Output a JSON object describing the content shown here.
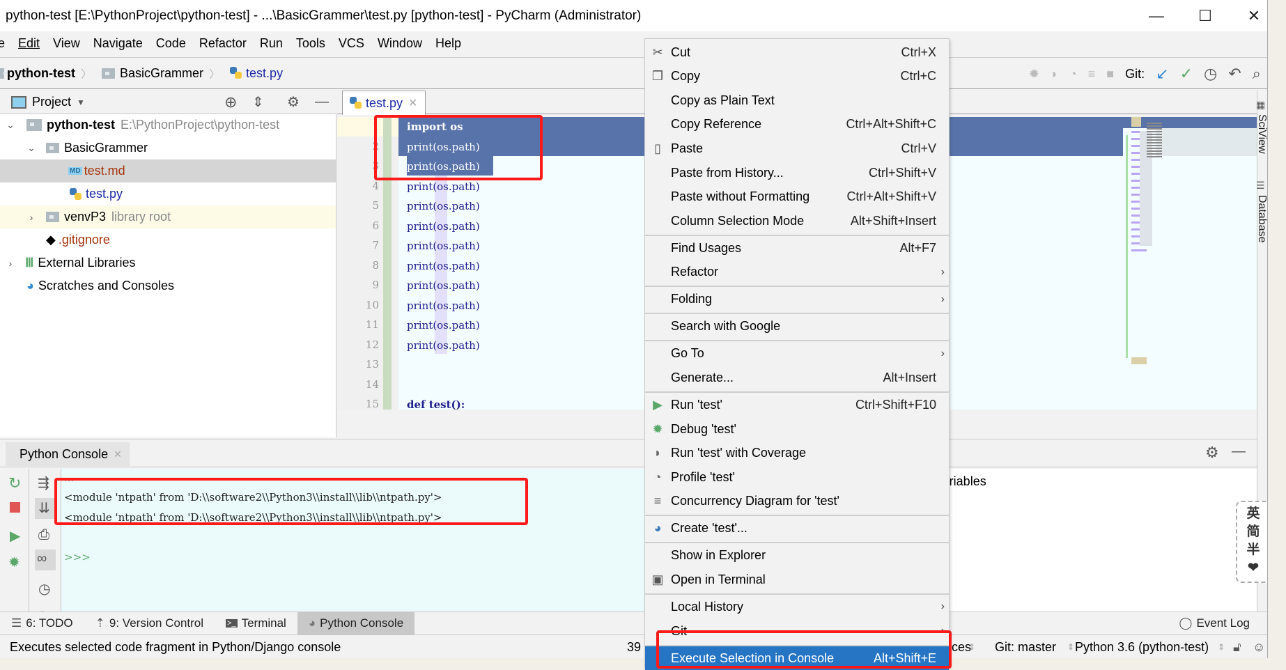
{
  "window": {
    "title": "python-test [E:\\PythonProject\\python-test] - ...\\BasicGrammer\\test.py [python-test] - PyCharm (Administrator)",
    "minimize": "—",
    "maximize": "☐",
    "close": "✕"
  },
  "menubar": [
    "e",
    "Edit",
    "View",
    "Navigate",
    "Code",
    "Refactor",
    "Run",
    "Tools",
    "VCS",
    "Window",
    "Help"
  ],
  "breadcrumb": [
    "python-test",
    "BasicGrammer",
    "test.py"
  ],
  "toolbar": {
    "git_label": "Git:"
  },
  "project": {
    "header": "Project",
    "tree": [
      {
        "label": "python-test",
        "hint": "E:\\PythonProject\\python-test"
      },
      {
        "label": "BasicGrammer"
      },
      {
        "label": "test.md"
      },
      {
        "label": "test.py"
      },
      {
        "label": "venvP3",
        "hint": "library root"
      },
      {
        "label": ".gitignore"
      },
      {
        "label": "External Libraries"
      },
      {
        "label": "Scratches and Consoles"
      }
    ]
  },
  "editor": {
    "tab": "test.py",
    "lines": [
      {
        "n": "1",
        "code": "import os"
      },
      {
        "n": "2",
        "code": "print(os.path)"
      },
      {
        "n": "3",
        "code": "print(os.path)"
      },
      {
        "n": "4",
        "code": "print(os.path)"
      },
      {
        "n": "5",
        "code": "print(os.path)"
      },
      {
        "n": "6",
        "code": "print(os.path)"
      },
      {
        "n": "7",
        "code": "print(os.path)"
      },
      {
        "n": "8",
        "code": "print(os.path)"
      },
      {
        "n": "9",
        "code": "print(os.path)"
      },
      {
        "n": "10",
        "code": "print(os.path)"
      },
      {
        "n": "11",
        "code": "print(os.path)"
      },
      {
        "n": "12",
        "code": "print(os.path)"
      },
      {
        "n": "13",
        "code": ""
      },
      {
        "n": "14",
        "code": ""
      },
      {
        "n": "15",
        "code": "def test():"
      }
    ]
  },
  "console": {
    "tab": "Python Console",
    "lines": [
      "...",
      "<module 'ntpath' from 'D:\\\\software2\\\\Python3\\\\install\\\\lib\\\\ntpath.py'>",
      "<module 'ntpath' from 'D:\\\\software2\\\\Python3\\\\install\\\\lib\\\\ntpath.py'>"
    ],
    "prompt": ">>>",
    "variables": "Variables"
  },
  "context_menu": [
    {
      "label": "Cut",
      "shortcut": "Ctrl+X",
      "icon": "scissors"
    },
    {
      "label": "Copy",
      "shortcut": "Ctrl+C",
      "icon": "copy"
    },
    {
      "label": "Copy as Plain Text",
      "shortcut": ""
    },
    {
      "label": "Copy Reference",
      "shortcut": "Ctrl+Alt+Shift+C"
    },
    {
      "label": "Paste",
      "shortcut": "Ctrl+V",
      "icon": "clipboard"
    },
    {
      "label": "Paste from History...",
      "shortcut": "Ctrl+Shift+V"
    },
    {
      "label": "Paste without Formatting",
      "shortcut": "Ctrl+Alt+Shift+V"
    },
    {
      "label": "Column Selection Mode",
      "shortcut": "Alt+Shift+Insert"
    },
    {
      "label": "Find Usages",
      "shortcut": "Alt+F7"
    },
    {
      "label": "Refactor",
      "submenu": true
    },
    {
      "label": "Folding",
      "submenu": true
    },
    {
      "label": "Search with Google",
      "shortcut": ""
    },
    {
      "label": "Go To",
      "submenu": true
    },
    {
      "label": "Generate...",
      "shortcut": "Alt+Insert"
    },
    {
      "label": "Run 'test'",
      "shortcut": "Ctrl+Shift+F10",
      "icon": "run"
    },
    {
      "label": "Debug 'test'",
      "shortcut": "",
      "icon": "debug"
    },
    {
      "label": "Run 'test' with Coverage",
      "shortcut": "",
      "icon": "coverage"
    },
    {
      "label": "Profile 'test'",
      "shortcut": "",
      "icon": "profile"
    },
    {
      "label": "Concurrency Diagram for 'test'",
      "shortcut": "",
      "icon": "concurrency"
    },
    {
      "label": "Create 'test'...",
      "shortcut": "",
      "icon": "python"
    },
    {
      "label": "Show in Explorer",
      "shortcut": ""
    },
    {
      "label": "Open in Terminal",
      "shortcut": "",
      "icon": "terminal"
    },
    {
      "label": "Local History",
      "submenu": true
    },
    {
      "label": "Git",
      "submenu": true
    },
    {
      "label": "Execute Selection in Console",
      "shortcut": "Alt+Shift+E",
      "selected": true
    }
  ],
  "bottom_tabs": [
    "6: TODO",
    "9: Version Control",
    "Terminal",
    "Python Console"
  ],
  "event_log": "Event Log",
  "status": {
    "message": "Executes selected code fragment in Python/Django console",
    "position": "39",
    "encoding_tail": "ces",
    "git": "Git: master",
    "interpreter": "Python 3.6 (python-test)"
  },
  "side_tools": [
    "SciView",
    "Database"
  ],
  "ime": [
    "英",
    "简",
    "半",
    "❤"
  ],
  "colors": {
    "selection": "#5873aa",
    "highlight_box": "#ff1a1a",
    "menu_selected": "#2675c5",
    "run_green": "#59a869"
  }
}
